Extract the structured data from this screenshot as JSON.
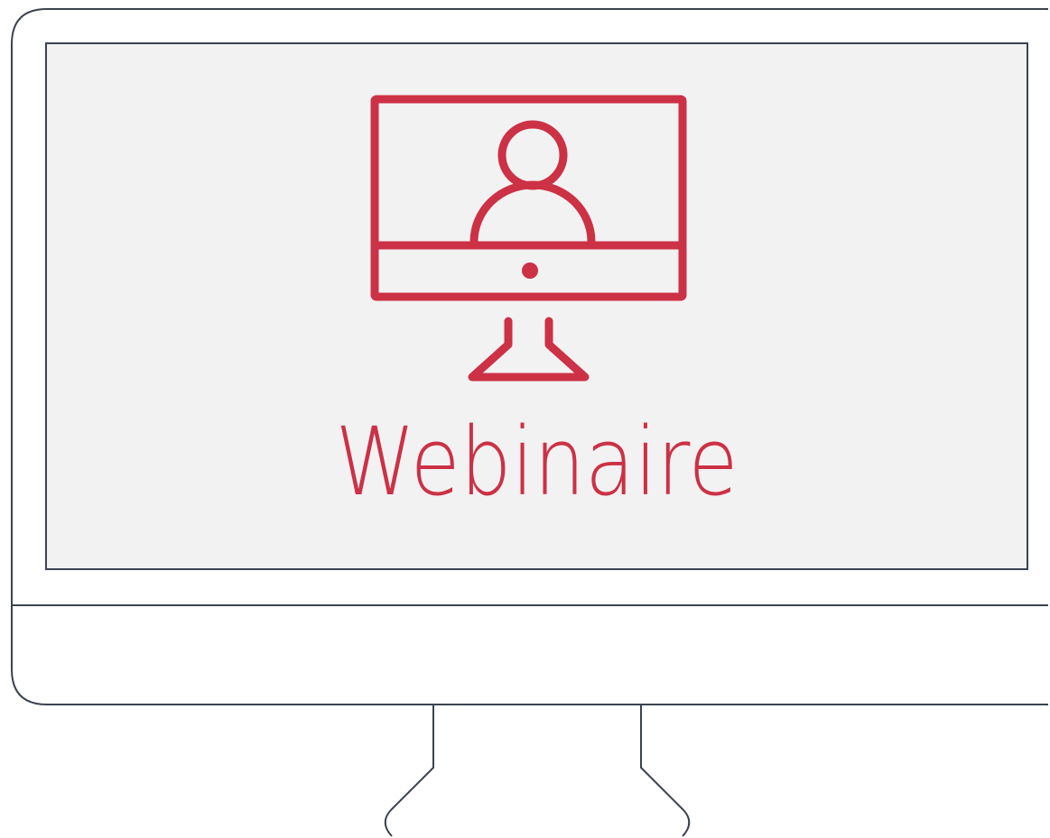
{
  "screen": {
    "caption": "Webinaire"
  },
  "icons": {
    "hero_icon": "webinar-monitor-icon",
    "person": "person-icon"
  },
  "colors": {
    "accent": "#cc3145",
    "outline": "#3b4350",
    "screen_bg": "#f2f2f2",
    "page_bg": "#ffffff"
  }
}
